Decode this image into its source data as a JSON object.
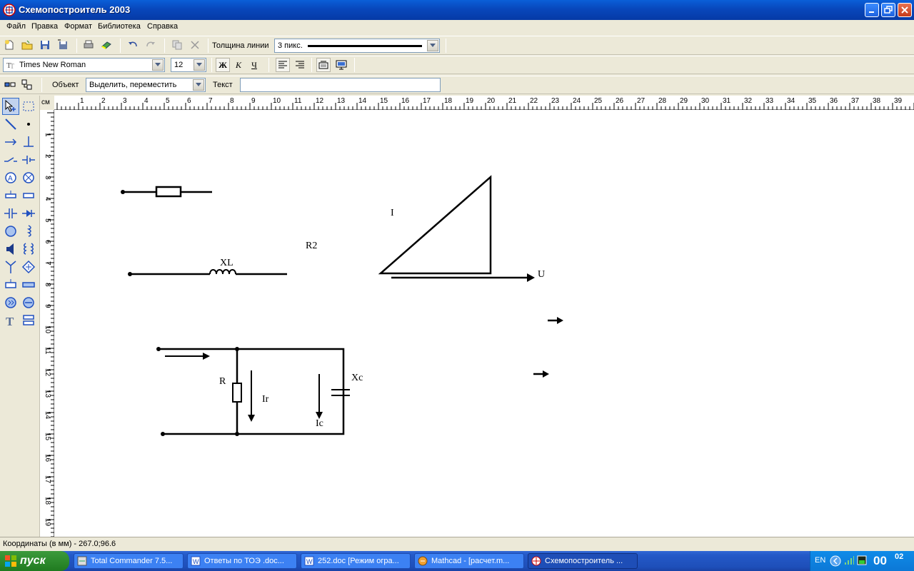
{
  "window": {
    "title": "Схемопостроитель 2003"
  },
  "menu": [
    "Файл",
    "Правка",
    "Формат",
    "Библиотека",
    "Справка"
  ],
  "toolbar1": {
    "line_width_label": "Толщина линии",
    "line_width_value": "3 пикс."
  },
  "toolbar2": {
    "font": "Times New Roman",
    "font_size": "12",
    "bold": "Ж",
    "italic": "К",
    "underline": "Ч"
  },
  "toolbar3": {
    "object_label": "Объект",
    "object_mode": "Выделить, переместить",
    "text_label": "Текст",
    "text_value": ""
  },
  "ruler": {
    "unit": "см",
    "top_marks": [
      "1",
      "2",
      "3",
      "4",
      "5",
      "6",
      "7",
      "8",
      "9",
      "10",
      "11",
      "12",
      "13",
      "14",
      "15",
      "16",
      "17",
      "18",
      "19",
      "20",
      "21",
      "22",
      "23",
      "24",
      "25",
      "26",
      "27",
      "28",
      "29",
      "30",
      "31",
      "32",
      "33",
      "34",
      "35",
      "36",
      "37",
      "38",
      "39"
    ],
    "left_marks": [
      "1",
      "2",
      "3",
      "4",
      "5",
      "6",
      "7",
      "8",
      "9",
      "10",
      "11",
      "12",
      "13",
      "14",
      "15",
      "16",
      "17",
      "18",
      "19"
    ]
  },
  "canvas_labels": {
    "xl": "XL",
    "r2": "R2",
    "i": "I",
    "u": "U",
    "r": "R",
    "ir": "Ir",
    "xc": "Xc",
    "ic": "Ic"
  },
  "status": {
    "coords": "Координаты (в мм) - 267.0;96.6"
  },
  "taskbar": {
    "start": "пуск",
    "tasks": [
      "Total Commander 7.5...",
      "Ответы по ТОЭ .doc...",
      "252.doc [Режим огра...",
      "Mathcad - [расчет.m...",
      "Схемопостроитель ..."
    ],
    "lang": "EN",
    "clock_hour": "00",
    "clock_min": "02"
  }
}
